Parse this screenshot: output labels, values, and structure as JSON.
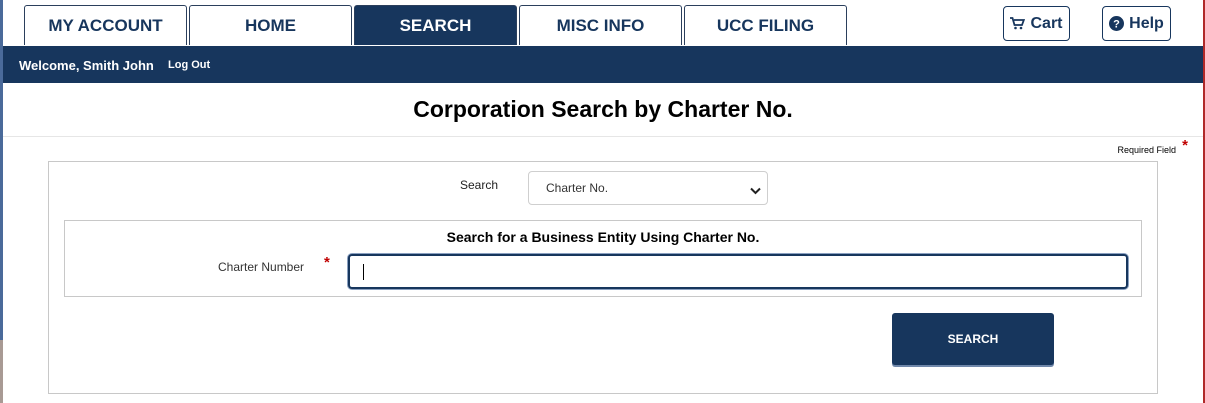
{
  "tabs": [
    {
      "label": "MY ACCOUNT"
    },
    {
      "label": "HOME"
    },
    {
      "label": "SEARCH",
      "active": true
    },
    {
      "label": "MISC INFO"
    },
    {
      "label": "UCC FILING"
    }
  ],
  "toolbar": {
    "cart_label": "Cart",
    "help_label": "Help"
  },
  "nav": {
    "welcome": "Welcome, Smith John",
    "logout": "Log Out"
  },
  "page": {
    "title": "Corporation Search by Charter No."
  },
  "form": {
    "required_note": "Required Field",
    "required_marker": "*",
    "search_label": "Search",
    "search_selected": "Charter No.",
    "section_title": "Search for a Business Entity Using Charter No.",
    "charter_label": "Charter Number",
    "charter_value": "",
    "submit_label": "SEARCH"
  },
  "icons": {
    "cart": "shopping-cart-icon",
    "help": "question-circle-icon",
    "select": "chevron-down-icon"
  },
  "colors": {
    "brand": "#17365d",
    "required": "#c00000"
  }
}
